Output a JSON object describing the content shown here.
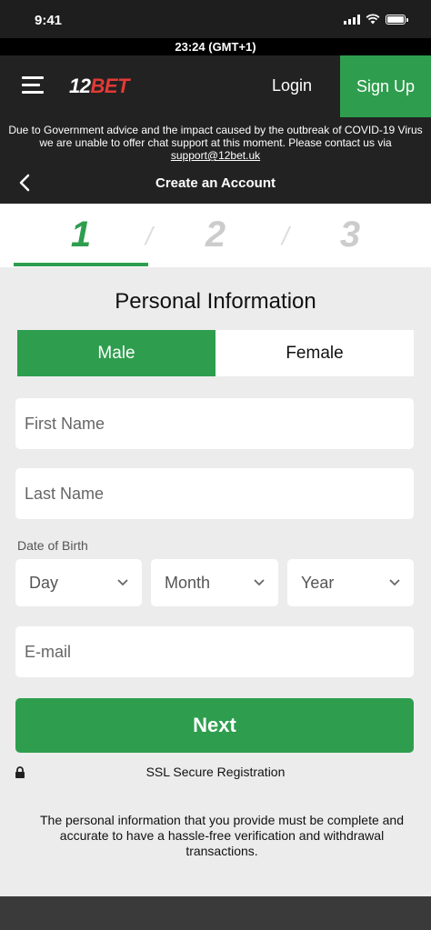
{
  "status_bar": {
    "time": "9:41"
  },
  "clock": {
    "text": "23:24 (GMT+1)"
  },
  "navbar": {
    "logo_number": "12",
    "logo_text": "BET",
    "login_label": "Login",
    "signup_label": "Sign Up"
  },
  "notice": {
    "text": "Due to Government advice and the impact caused by the outbreak of COVID-19 Virus we are unable to offer chat support at this moment. Please contact us via ",
    "email": "support@12bet.uk"
  },
  "header": {
    "title": "Create an Account"
  },
  "steps": {
    "items": [
      "1",
      "2",
      "3"
    ],
    "active": "1"
  },
  "form": {
    "section_title": "Personal Information",
    "gender": {
      "male": "Male",
      "female": "Female",
      "selected": "Male"
    },
    "first_name_placeholder": "First Name",
    "last_name_placeholder": "Last Name",
    "dob_label": "Date of Birth",
    "day_label": "Day",
    "month_label": "Month",
    "year_label": "Year",
    "email_placeholder": "E-mail",
    "next_label": "Next",
    "ssl_text": "SSL Secure Registration",
    "disclaimer": "The personal information that you provide must be complete and accurate to have a hassle-free verification and withdrawal transactions."
  },
  "colors": {
    "accent": "#2e9e4e",
    "logo_red": "#e53935",
    "dark": "#222222",
    "background": "#ececec"
  }
}
